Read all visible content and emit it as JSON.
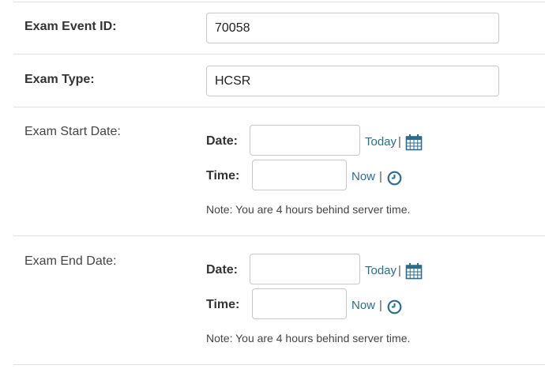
{
  "exam_event": {
    "label": "Exam Event ID:",
    "value": "70058"
  },
  "exam_type": {
    "label": "Exam Type:",
    "value": "HCSR"
  },
  "start_date": {
    "label": "Exam Start Date:",
    "date_label": "Date:",
    "date_value": "",
    "today_link": "Today",
    "separator": "|",
    "time_label": "Time:",
    "time_value": "",
    "now_link": "Now",
    "note": "Note: You are 4 hours behind server time."
  },
  "end_date": {
    "label": "Exam End Date:",
    "date_label": "Date:",
    "date_value": "",
    "today_link": "Today",
    "separator": "|",
    "time_label": "Time:",
    "time_value": "",
    "now_link": "Now",
    "note": "Note: You are 4 hours behind server time."
  },
  "colors": {
    "link": "#2b6d8c",
    "icon": "#2b6d8c",
    "divider": "#e1e1e1"
  },
  "icons": {
    "calendar": "calendar-icon",
    "clock": "clock-icon"
  }
}
